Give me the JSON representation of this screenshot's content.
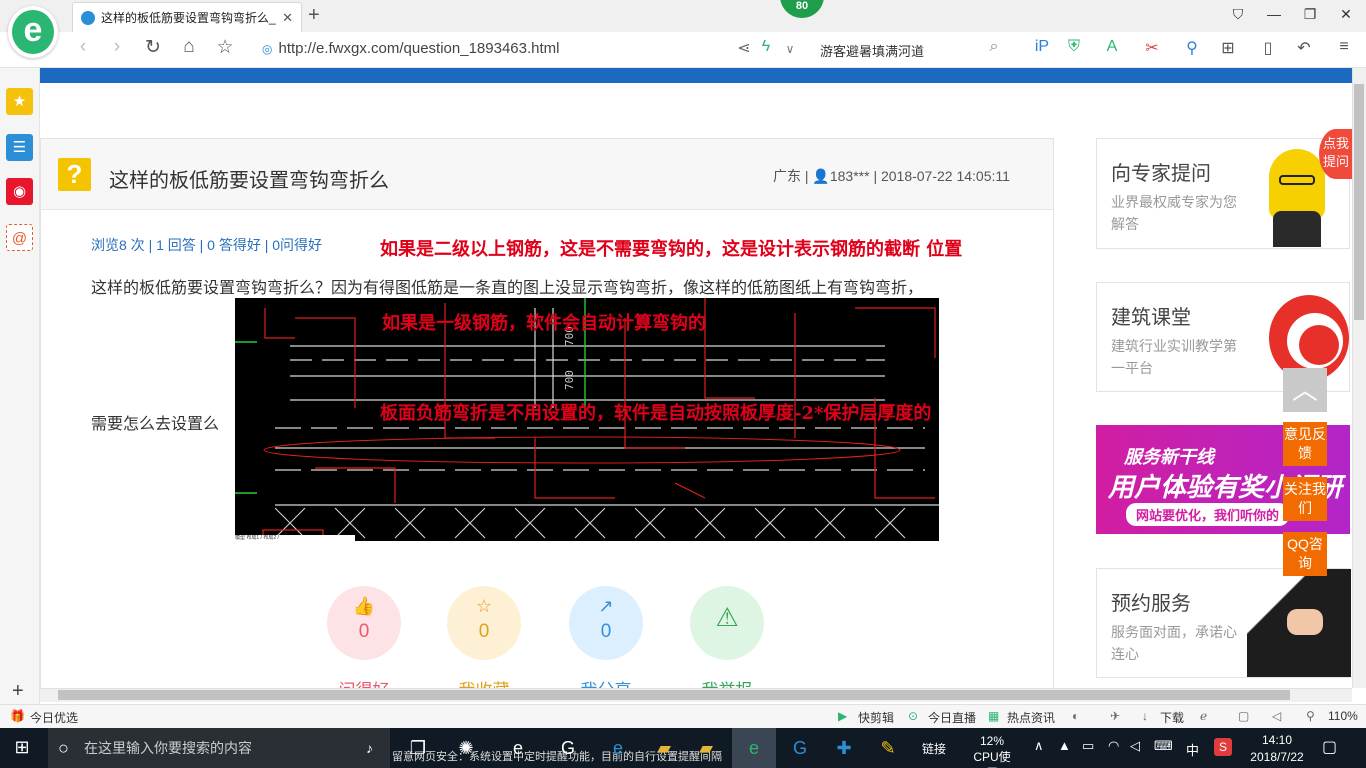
{
  "browser": {
    "logo_letter": "e",
    "tab_title": "这样的板低筋要设置弯钩弯折么_",
    "tab_close": "✕",
    "new_tab": "+",
    "badge": "80",
    "url": "http://e.fwxgx.com/question_1893463.html",
    "search_text": "游客避暑填满河道",
    "window_buttons": [
      "⛉",
      "—",
      "❐",
      "✕"
    ]
  },
  "question": {
    "title": "这样的板低筋要设置弯钩弯折么",
    "meta": "广东 | 👤183*** | 2018-07-22 14:05:11",
    "stats": "浏览8 次 | 1 回答 | 0 答得好 | 0问得好",
    "body": "这样的板低筋要设置弯钩弯折么？因为有得图低筋是一条直的图上没显示弯钩弯折，像这样的低筋图纸上有弯钩弯折，",
    "ask": "需要怎么去设置么"
  },
  "annotations": {
    "line1": "如果是二级以上钢筋，这是不需要弯钩的，这是设计表示钢筋的截断 位置",
    "line2": "如果是一级钢筋，软件会自动计算弯钩的",
    "line3": "板面负筋弯折是不用设置的，软件是自动按照板厚度-2*保护层厚度的"
  },
  "cad": {
    "dim1": "700",
    "dim2": "700",
    "foot": "模型 布局1 / 布局2 /"
  },
  "actions": [
    {
      "icon": "👍",
      "count": "0",
      "label": "问得好",
      "color": "#e85a6b",
      "bg": "#fde3e6"
    },
    {
      "icon": "☆",
      "count": "0",
      "label": "我收藏",
      "color": "#e0a21c",
      "bg": "#fdf0d4"
    },
    {
      "icon": "↗",
      "count": "0",
      "label": "我分享",
      "color": "#3a8fd8",
      "bg": "#dcefff"
    },
    {
      "icon": "⚠",
      "count": "",
      "label": "我举报",
      "color": "#3aa55a",
      "bg": "#dff5e3"
    }
  ],
  "right": {
    "card1_title": "向专家提问",
    "card1_sub": "业界最权威专家为您解答",
    "corner": "点我提问",
    "card2_title": "建筑课堂",
    "card2_sub": "建筑行业实训教学第一平台",
    "promo_title": "服务新干线",
    "promo_main": "用户体验有奖小调研",
    "promo_sub": "网站要优化，我们听你的",
    "card3_title": "预约服务",
    "card3_sub": "服务面对面，承诺心连心"
  },
  "floating": {
    "feedback": "意见反馈",
    "follow": "关注我们",
    "qq": "QQ咨询"
  },
  "status": {
    "left": "今日优选",
    "items": [
      "快剪辑",
      "今日直播",
      "热点资讯",
      "下载",
      "110%"
    ]
  },
  "taskbar": {
    "search_placeholder": "在这里输入你要搜索的内容",
    "ticker": "留意网页安全：系统设置中定时提醒功能，目前的自行设置提醒间隔…",
    "link": "链接",
    "cpu": "12%",
    "cpu_label": "CPU使用",
    "ime": "中",
    "time": "14:10",
    "date": "2018/7/22"
  },
  "colors": {
    "accent_blue": "#1b6ac0",
    "annotation_red": "#e0001a",
    "float_orange": "#f26b00"
  }
}
